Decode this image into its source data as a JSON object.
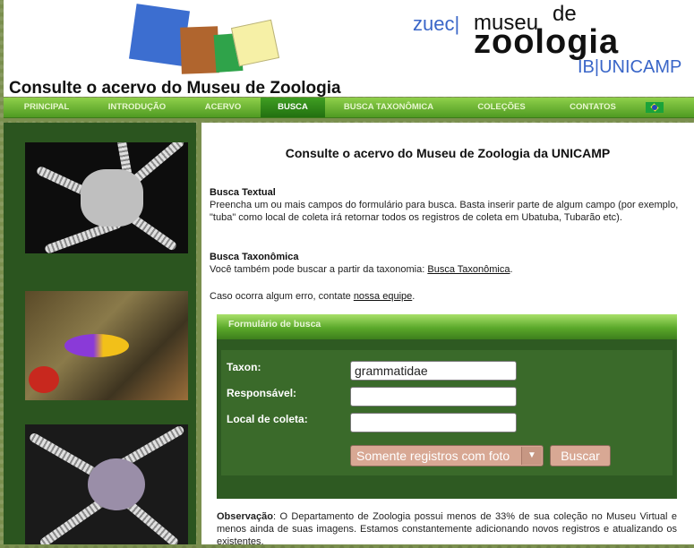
{
  "header": {
    "brand": {
      "zuec": "zuec|",
      "museu": "museu",
      "de": "de",
      "zoologia": "zoologia",
      "ib": "IB|UNICAMP"
    },
    "page_title": "Consulte o acervo do Museu de Zoologia"
  },
  "nav": {
    "items": [
      "PRINCIPAL",
      "INTRODUÇÃO",
      "ACERVO",
      "BUSCA",
      "BUSCA TAXONÔMICA",
      "COLEÇÕES",
      "CONTATOS"
    ],
    "active": "BUSCA",
    "flag_icon": "brazil-flag-icon"
  },
  "content": {
    "title": "Consulte o acervo do Museu de Zoologia da UNICAMP",
    "textual": {
      "heading": "Busca Textual",
      "body": "Preencha um ou mais campos do formulário para busca. Basta inserir parte de algum campo (por exemplo, \"tuba\" como local de coleta irá retornar todos os registros de coleta em Ubatuba, Tubarão etc)."
    },
    "taxonomic": {
      "heading": "Busca Taxonômica",
      "body_prefix": "Você também pode buscar a partir da taxonomia: ",
      "link": "Busca Taxonômica",
      "body_suffix": "."
    },
    "error": {
      "prefix": "Caso ocorra algum erro, contate ",
      "link": "nossa equipe",
      "suffix": "."
    },
    "form": {
      "title": "Formulário de busca",
      "fields": {
        "taxon_label": "Taxon:",
        "taxon_value": "grammatidae",
        "responsavel_label": "Responsável:",
        "responsavel_value": "",
        "local_label": "Local de coleta:",
        "local_value": ""
      },
      "select_value": "Somente registros com foto",
      "submit_label": "Buscar"
    },
    "observation": {
      "label": "Observação",
      "text": ": O Departamento de Zoologia possui menos de 33% de sua coleção no Museu Virtual e menos ainda de suas imagens. Estamos constantemente adicionando novos registros e atualizando os existentes."
    }
  },
  "colors": {
    "nav_green": "#5aa82a",
    "sidebar_green": "#2b551f",
    "form_green": "#2e5a22",
    "button_tan": "#d8a894"
  }
}
